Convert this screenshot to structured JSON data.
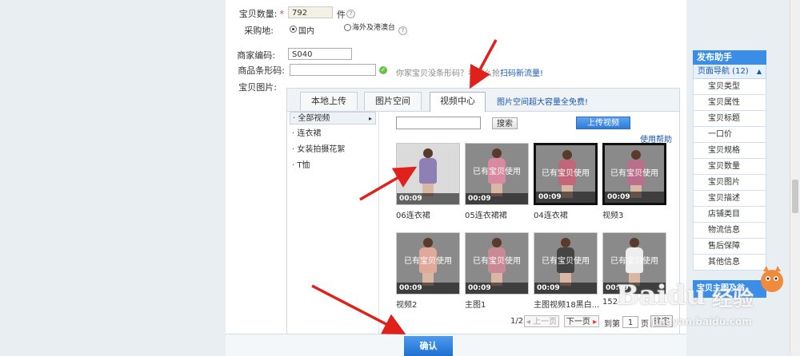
{
  "form": {
    "qty_label": "宝贝数量:",
    "qty_required": "*",
    "qty_value": "792",
    "qty_unit": "件",
    "origin_label": "采购地:",
    "origin_domestic": "国内",
    "origin_overseas": "海外及港澳台",
    "merchant_code_label": "商家编码:",
    "merchant_code_value": "S040",
    "barcode_label": "商品条形码:",
    "barcode_hint": "你家宝贝没条形码？看怎么抢",
    "barcode_link": "扫码新流量!",
    "images_label": "宝贝图片:"
  },
  "tabs": {
    "local": "本地上传",
    "image_space": "图片空间",
    "video_center": "视频中心",
    "promo": "图片空间超大容量全免费!"
  },
  "categories": [
    "全部视频",
    "连衣裙",
    "女装拍摄花絮",
    "T恤"
  ],
  "toolbar": {
    "search_button": "搜索",
    "upload_button": "上传视频",
    "help_link": "使用帮助"
  },
  "videos": [
    {
      "caption": "06连衣裙",
      "duration": "00:09",
      "status": "",
      "style": "light",
      "dress": "#8e7fb5"
    },
    {
      "caption": "05连衣裙裙",
      "duration": "00:09",
      "status": "已有宝贝使用",
      "style": "gray",
      "dress": "#d98aa0"
    },
    {
      "caption": "04连衣裙",
      "duration": "00:09",
      "status": "已有宝贝使用",
      "style": "dark",
      "dress": "#c0687a"
    },
    {
      "caption": "视频3",
      "duration": "00:09",
      "status": "已有宝贝使用",
      "style": "dark",
      "dress": "#b9708a"
    },
    {
      "caption": "视频2",
      "duration": "00:09",
      "status": "已有宝贝使用",
      "style": "gray",
      "dress": "#e0a99a"
    },
    {
      "caption": "主图1",
      "duration": "00:09",
      "status": "已有宝贝使用",
      "style": "gray",
      "dress": "#c98a96"
    },
    {
      "caption": "主图视频18黑白...",
      "duration": "00:09",
      "status": "已有宝贝使用",
      "style": "gray",
      "dress": "#444444"
    },
    {
      "caption": "152",
      "duration": "00:09",
      "status": "已有宝贝使用",
      "style": "gray",
      "dress": "#eeeeee"
    }
  ],
  "pager": {
    "page": "1/2",
    "prev": "上一页",
    "next": "下一页",
    "goto_prefix": "到第",
    "goto_value": "1",
    "goto_suffix": "页",
    "confirm": "确定"
  },
  "sidebar": {
    "title": "发布助手",
    "nav_label": "页面导航 (12)",
    "items": [
      "宝贝类型",
      "宝贝属性",
      "宝贝标题",
      "一口价",
      "宝贝规格",
      "宝贝数量",
      "宝贝图片",
      "宝贝描述",
      "店铺类目",
      "物流信息",
      "售后保障",
      "其他信息"
    ],
    "footer": "宝贝主图及翁"
  },
  "bottom": {
    "confirm_button": "确认"
  },
  "watermark": {
    "brand": "Baidu",
    "brand_cn": "经验",
    "url": "jingyan.baidu.com"
  }
}
